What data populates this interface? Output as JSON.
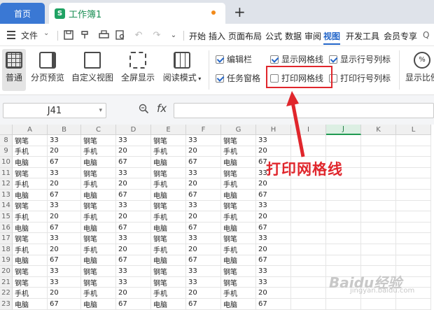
{
  "tabs": {
    "home": "首页",
    "doc": "工作簿1",
    "doc_icon": "S",
    "new_tab": "+"
  },
  "menu": {
    "file": "文件",
    "items": [
      "开始",
      "插入",
      "页面布局",
      "公式",
      "数据",
      "审阅",
      "视图",
      "开发工具",
      "会员专享"
    ]
  },
  "ribbon": {
    "buttons": [
      "普通",
      "分页预览",
      "自定义视图",
      "全屏显示",
      "阅读模式"
    ],
    "checks": [
      {
        "label": "编辑栏",
        "checked": true
      },
      {
        "label": "显示网格线",
        "checked": true
      },
      {
        "label": "显示行号列标",
        "checked": true
      },
      {
        "label": "任务窗格",
        "checked": true
      },
      {
        "label": "打印网格线",
        "checked": false
      },
      {
        "label": "打印行号列标",
        "checked": false
      }
    ],
    "zoom_label": "显示比例"
  },
  "formula": {
    "cell_ref": "J41",
    "fx": "fx",
    "value": ""
  },
  "sheet": {
    "columns": [
      "A",
      "B",
      "C",
      "D",
      "E",
      "F",
      "G",
      "H",
      "I",
      "J",
      "K",
      "L"
    ],
    "selected_column": "J",
    "rows": [
      {
        "n": "8",
        "v": [
          "钢笔",
          "33",
          "钢笔",
          "33",
          "钢笔",
          "33",
          "钢笔",
          "33"
        ]
      },
      {
        "n": "9",
        "v": [
          "手机",
          "20",
          "手机",
          "20",
          "手机",
          "20",
          "手机",
          "20"
        ]
      },
      {
        "n": "10",
        "v": [
          "电脑",
          "67",
          "电脑",
          "67",
          "电脑",
          "67",
          "电脑",
          "67"
        ]
      },
      {
        "n": "11",
        "v": [
          "钢笔",
          "33",
          "钢笔",
          "33",
          "钢笔",
          "33",
          "钢笔",
          "33"
        ]
      },
      {
        "n": "12",
        "v": [
          "手机",
          "20",
          "手机",
          "20",
          "手机",
          "20",
          "手机",
          "20"
        ]
      },
      {
        "n": "13",
        "v": [
          "电脑",
          "67",
          "电脑",
          "67",
          "电脑",
          "67",
          "电脑",
          "67"
        ]
      },
      {
        "n": "14",
        "v": [
          "钢笔",
          "33",
          "钢笔",
          "33",
          "钢笔",
          "33",
          "钢笔",
          "33"
        ]
      },
      {
        "n": "15",
        "v": [
          "手机",
          "20",
          "手机",
          "20",
          "手机",
          "20",
          "手机",
          "20"
        ]
      },
      {
        "n": "16",
        "v": [
          "电脑",
          "67",
          "电脑",
          "67",
          "电脑",
          "67",
          "电脑",
          "67"
        ]
      },
      {
        "n": "17",
        "v": [
          "钢笔",
          "33",
          "钢笔",
          "33",
          "钢笔",
          "33",
          "钢笔",
          "33"
        ]
      },
      {
        "n": "18",
        "v": [
          "手机",
          "20",
          "手机",
          "20",
          "手机",
          "20",
          "手机",
          "20"
        ]
      },
      {
        "n": "19",
        "v": [
          "电脑",
          "67",
          "电脑",
          "67",
          "电脑",
          "67",
          "电脑",
          "67"
        ]
      },
      {
        "n": "20",
        "v": [
          "钢笔",
          "33",
          "钢笔",
          "33",
          "钢笔",
          "33",
          "钢笔",
          "33"
        ]
      },
      {
        "n": "21",
        "v": [
          "钢笔",
          "33",
          "钢笔",
          "33",
          "钢笔",
          "33",
          "钢笔",
          "33"
        ]
      },
      {
        "n": "22",
        "v": [
          "手机",
          "20",
          "手机",
          "20",
          "手机",
          "20",
          "手机",
          "20"
        ]
      },
      {
        "n": "23",
        "v": [
          "电脑",
          "67",
          "电脑",
          "67",
          "电脑",
          "67",
          "电脑",
          "67"
        ]
      }
    ]
  },
  "annotation": "打印网格线",
  "watermark": "Baidu经验",
  "watermark_sub": "jingyan.baidu.com",
  "colors": {
    "accent": "#2366c9",
    "home_tab": "#3a78d4",
    "highlight": "#e0262c",
    "sheet_green": "#1f9a51"
  }
}
